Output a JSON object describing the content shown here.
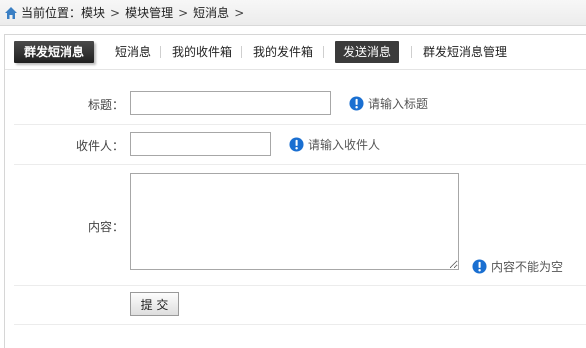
{
  "breadcrumb": {
    "prefix": "当前位置：",
    "items": [
      "模块",
      "模块管理",
      "短消息"
    ],
    "separator": ">"
  },
  "module_title": "群发短消息",
  "tabs": [
    {
      "label": "短消息",
      "active": false
    },
    {
      "label": "我的收件箱",
      "active": false
    },
    {
      "label": "我的发件箱",
      "active": false
    },
    {
      "label": "发送消息",
      "active": true
    },
    {
      "label": "群发短消息管理",
      "active": false
    }
  ],
  "form": {
    "title": {
      "label": "标题：",
      "value": "",
      "hint": "请输入标题"
    },
    "recipient": {
      "label": "收件人：",
      "value": "",
      "hint": "请输入收件人"
    },
    "content": {
      "label": "内容：",
      "value": "",
      "hint": "内容不能为空"
    },
    "submit_label": "提 交"
  },
  "colors": {
    "info_icon": "#1a6fd1",
    "active_tab_bg": "#3b3b3b",
    "badge_bg": "#2a2a2a"
  },
  "icons": {
    "home": "home-icon",
    "info": "info-icon"
  }
}
